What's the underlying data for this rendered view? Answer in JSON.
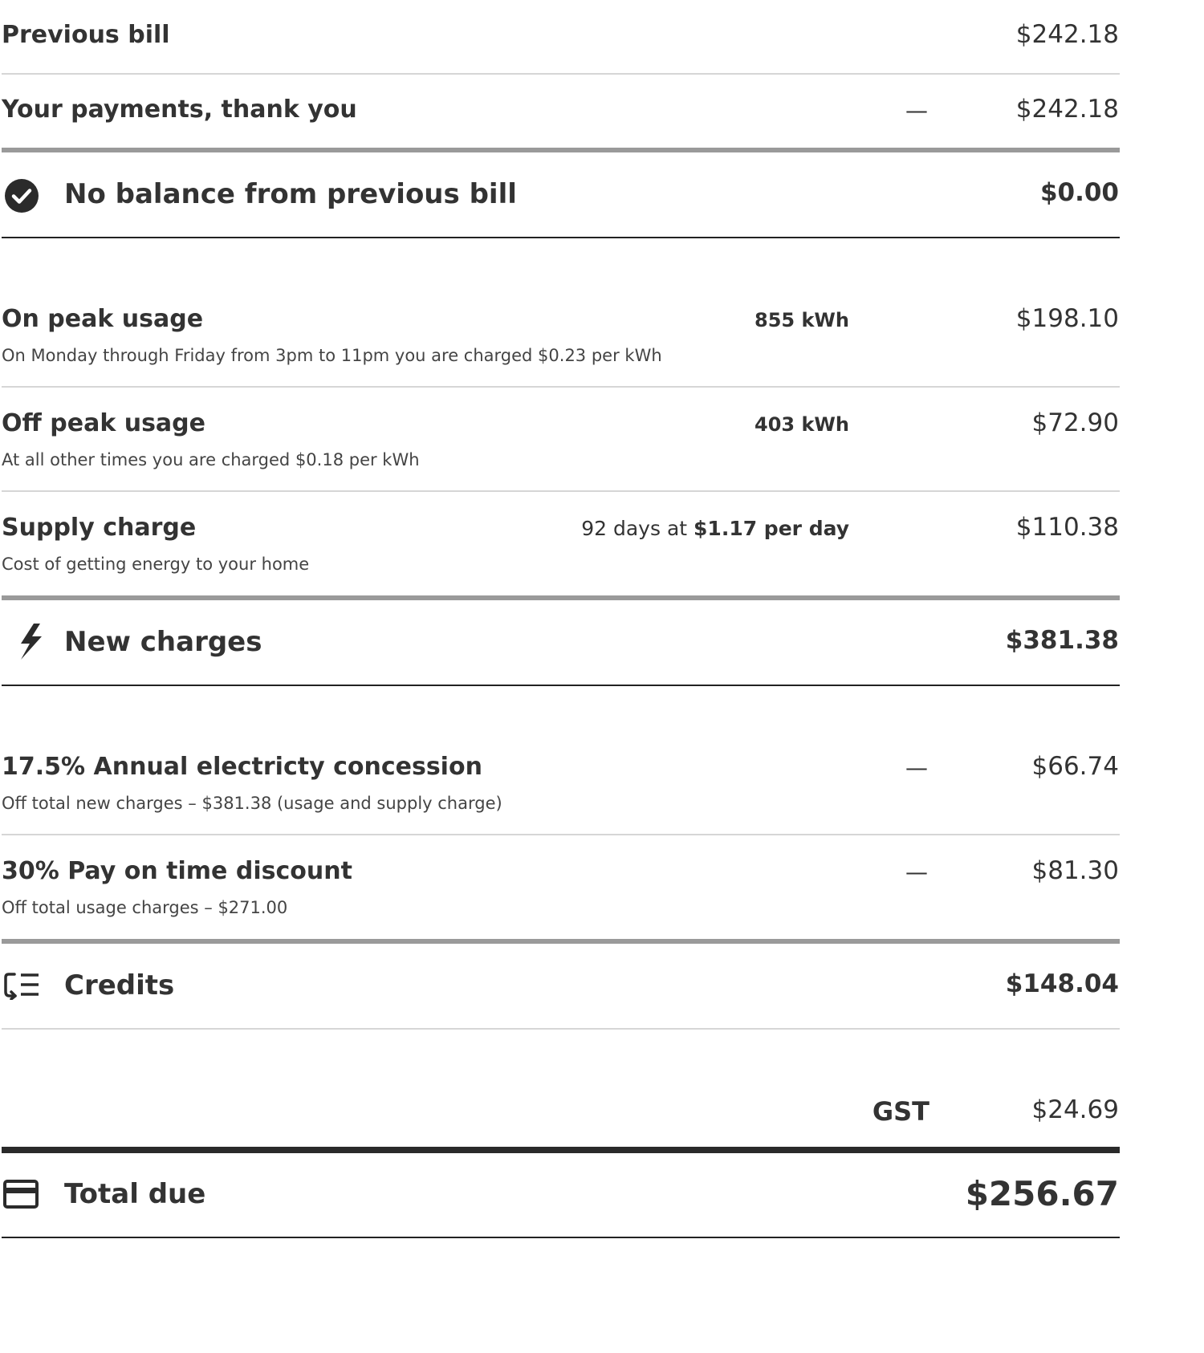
{
  "previous_bill": {
    "label": "Previous bill",
    "amount": "$242.18"
  },
  "payments": {
    "label": "Your payments, thank you",
    "minus": "—",
    "amount": "$242.18"
  },
  "balance": {
    "icon": "check-circle-icon",
    "label": "No balance from previous bill",
    "amount": "$0.00"
  },
  "usage": {
    "on_peak": {
      "label": "On peak usage",
      "qty": "855 kWh",
      "amount": "$198.10",
      "desc": "On Monday through Friday from 3pm to 11pm you are charged $0.23 per kWh"
    },
    "off_peak": {
      "label": "Off peak usage",
      "qty": "403 kWh",
      "amount": "$72.90",
      "desc": "At all other times you are charged $0.18 per kWh"
    },
    "supply": {
      "label": "Supply charge",
      "days_prefix": "92 days at",
      "rate": "$1.17 per day",
      "amount": "$110.38",
      "desc": "Cost of getting energy to your home"
    }
  },
  "new_charges": {
    "icon": "lightning-bolt-icon",
    "label": "New charges",
    "amount": "$381.38"
  },
  "discounts": {
    "concession": {
      "label": "17.5% Annual electricty concession",
      "minus": "—",
      "amount": "$66.74",
      "desc": "Off total new charges – $381.38 (usage and supply charge)"
    },
    "pay_on_time": {
      "label": "30% Pay on time discount",
      "minus": "—",
      "amount": "$81.30",
      "desc": "Off total usage charges – $271.00"
    }
  },
  "credits": {
    "icon": "credits-list-icon",
    "label": "Credits",
    "amount": "$148.04"
  },
  "gst": {
    "label": "GST",
    "amount": "$24.69"
  },
  "total": {
    "icon": "credit-card-icon",
    "label": "Total due",
    "amount": "$256.67"
  }
}
